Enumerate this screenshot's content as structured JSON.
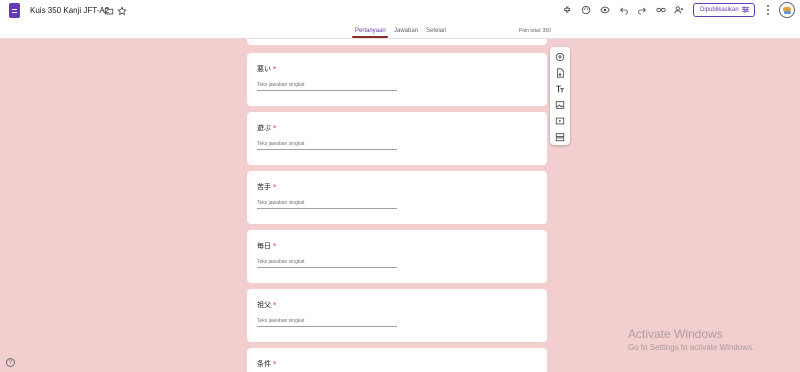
{
  "header": {
    "title": "Kuis 350 Kanji JFT-A2",
    "publish_label": "Dipublikasikan",
    "icons": [
      "forms-logo-icon",
      "folder-icon",
      "star-icon",
      "addon-icon",
      "palette-icon",
      "preview-eye-icon",
      "undo-icon",
      "redo-icon",
      "link-icon",
      "add-person-icon",
      "tune-icon",
      "more-vert-icon",
      "avatar"
    ]
  },
  "tabs": {
    "items": [
      "Pertanyaan",
      "Jawaban",
      "Setelan"
    ],
    "active_index": 0,
    "points_total": "Poin total: 350"
  },
  "questions": [
    {
      "title": "悪い",
      "required_mark": "*",
      "placeholder": "Teks jawaban singkat"
    },
    {
      "title": "遊ぶ",
      "required_mark": "*",
      "placeholder": "Teks jawaban singkat"
    },
    {
      "title": "苦手",
      "required_mark": "*",
      "placeholder": "Teks jawaban singkat"
    },
    {
      "title": "毎日",
      "required_mark": "*",
      "placeholder": "Teks jawaban singkat"
    },
    {
      "title": "祖父",
      "required_mark": "*",
      "placeholder": "Teks jawaban singkat"
    },
    {
      "title": "条件",
      "required_mark": "*"
    }
  ],
  "toolbar_actions": [
    "add-question-icon",
    "import-questions-icon",
    "add-title-icon",
    "add-image-icon",
    "add-video-icon",
    "add-section-icon"
  ],
  "watermark": {
    "title": "Activate Windows",
    "subtitle": "Go to Settings to activate Windows."
  },
  "help": {
    "icon": "?"
  },
  "colors": {
    "background": "#f2cece",
    "accent": "#673ab7",
    "tab_underline": "#8a2c2c",
    "required": "#d93025"
  }
}
